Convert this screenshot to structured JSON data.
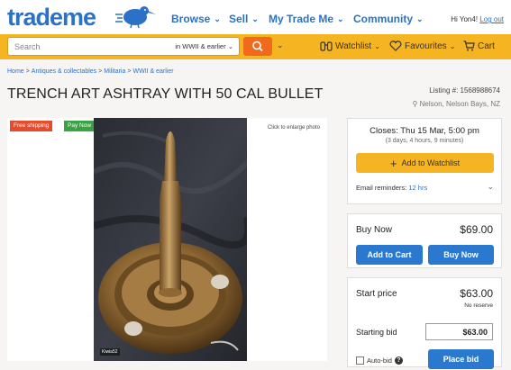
{
  "header": {
    "logo": "trademe",
    "nav": [
      "Browse",
      "Sell",
      "My Trade Me",
      "Community"
    ],
    "greeting": "Hi Yon4!",
    "logout": "Log out"
  },
  "search": {
    "placeholder": "Search",
    "scope": "in WWII & earlier",
    "watchlist": "Watchlist",
    "favourites": "Favourites",
    "cart": "Cart"
  },
  "breadcrumb": [
    "Home",
    "Antiques & collectables",
    "Militaria",
    "WWII & earlier"
  ],
  "listing": {
    "title": "TRENCH ART ASHTRAY WITH 50 CAL BULLET",
    "number": "Listing #: 1568988674",
    "location": "Nelson, Nelson Bays, NZ"
  },
  "photo": {
    "badge_shipping": "Free shipping",
    "badge_paynow": "Pay Now",
    "enlarge": "Click to enlarge photo",
    "watermark": "Kiwia52"
  },
  "closing": {
    "closes": "Closes: Thu 15 Mar, 5:00 pm",
    "remaining": "(3 days, 4 hours, 9 minutes)",
    "watch_btn": "Add to Watchlist",
    "reminders_label": "Email reminders:",
    "reminders_value": "12 hrs"
  },
  "buy_now": {
    "label": "Buy Now",
    "price": "$69.00",
    "add_cart": "Add to Cart",
    "buy_btn": "Buy Now"
  },
  "auction": {
    "start_label": "Start price",
    "start_price": "$63.00",
    "reserve": "No reserve",
    "starting_bid_label": "Starting bid",
    "starting_bid_value": "$63.00",
    "autobid": "Auto-bid",
    "place_bid": "Place bid"
  },
  "colors": {
    "brand_blue": "#2b72c7",
    "search_yellow": "#f5b422",
    "search_orange": "#f06a1e",
    "button_blue": "#2a79cf"
  }
}
